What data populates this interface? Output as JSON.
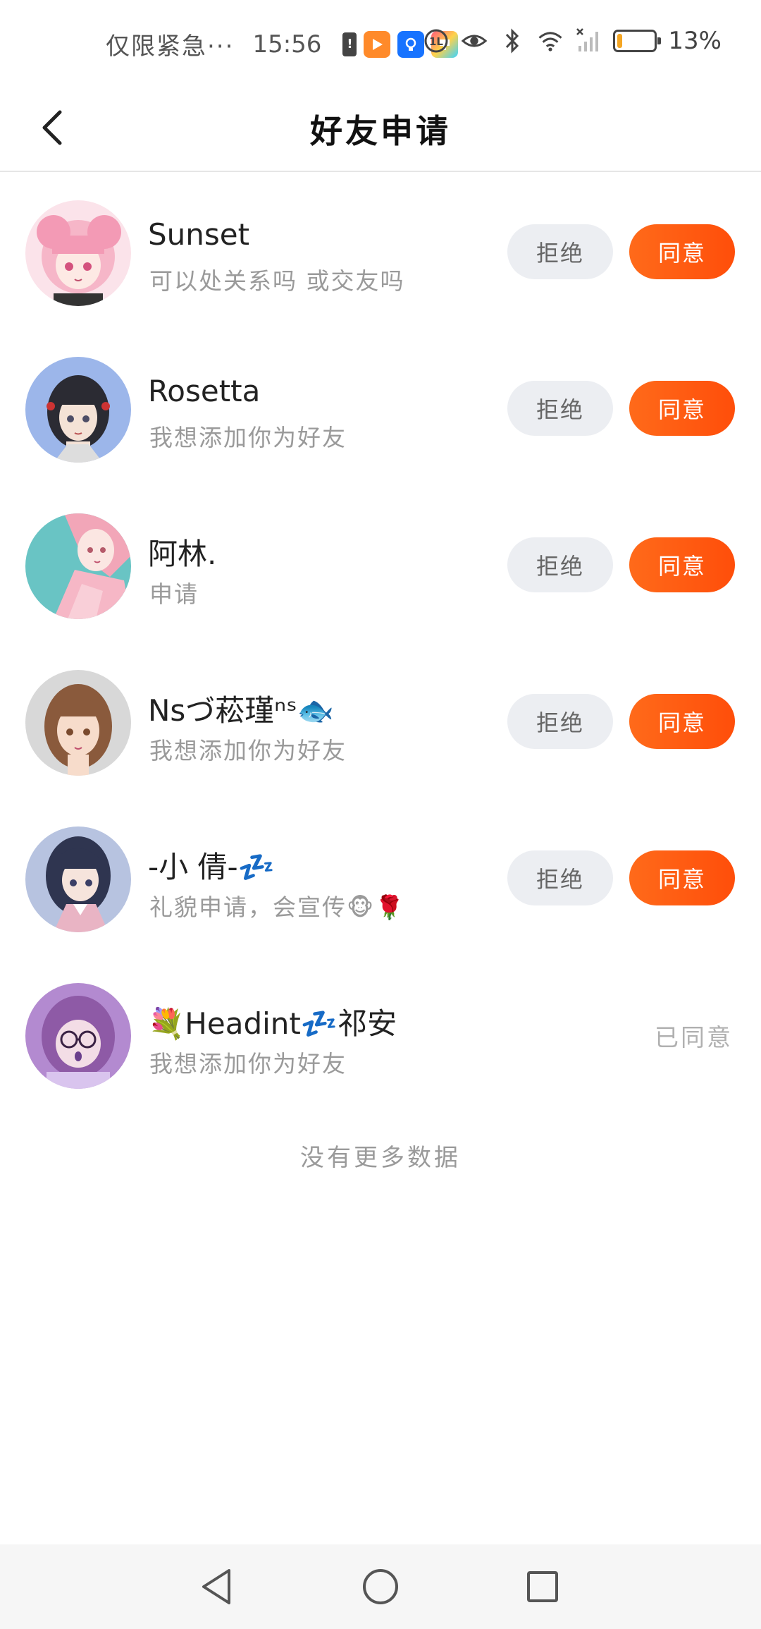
{
  "status_bar": {
    "carrier": "仅限紧急···",
    "time": "15:56",
    "battery_percent": "13%",
    "battery_level": 0.13,
    "icons": [
      "battery-warning-icon",
      "app-orange-icon",
      "app-blue-icon",
      "app-colorful-icon",
      "hd-icon",
      "eye-icon",
      "bluetooth-icon",
      "wifi-icon",
      "signal-icon",
      "battery-icon"
    ]
  },
  "header": {
    "title": "好友申请",
    "back_icon": "chevron-left-icon"
  },
  "requests": [
    {
      "name": "Sunset",
      "message": "可以处关系吗 或交友吗",
      "reject_label": "拒绝",
      "agree_label": "同意",
      "status": "pending",
      "avatar_colors": [
        "#f7c6d4",
        "#e88aa8"
      ]
    },
    {
      "name": "Rosetta",
      "message": "我想添加你为好友",
      "reject_label": "拒绝",
      "agree_label": "同意",
      "status": "pending",
      "avatar_colors": [
        "#9cb6ea",
        "#2b2b33"
      ]
    },
    {
      "name": "阿林.",
      "message": "申请",
      "reject_label": "拒绝",
      "agree_label": "同意",
      "status": "pending",
      "avatar_colors": [
        "#69c4c4",
        "#f2a6b8"
      ]
    },
    {
      "name": "Nsづ菘瑾ⁿˢ🐟",
      "message": "我想添加你为好友",
      "reject_label": "拒绝",
      "agree_label": "同意",
      "status": "pending",
      "avatar_colors": [
        "#d8d8d8",
        "#8a5a3c"
      ]
    },
    {
      "name": "-小 倩-💤",
      "message": "礼貌申请，会宣传🐵🌹",
      "reject_label": "拒绝",
      "agree_label": "同意",
      "status": "pending",
      "avatar_colors": [
        "#b7c3e0",
        "#2f3550"
      ]
    },
    {
      "name": "💐Headint💤祁安",
      "message": "我想添加你为好友",
      "status": "agreed",
      "status_label": "已同意",
      "avatar_colors": [
        "#b38ad0",
        "#6a3f8c"
      ]
    }
  ],
  "footer_text": "没有更多数据",
  "system_nav": {
    "icons": [
      "back-triangle-icon",
      "home-circle-icon",
      "recents-square-icon"
    ]
  },
  "colors": {
    "accent": "#ff5a12",
    "reject_bg": "#eceef2",
    "muted_text": "#9a9a9a"
  }
}
